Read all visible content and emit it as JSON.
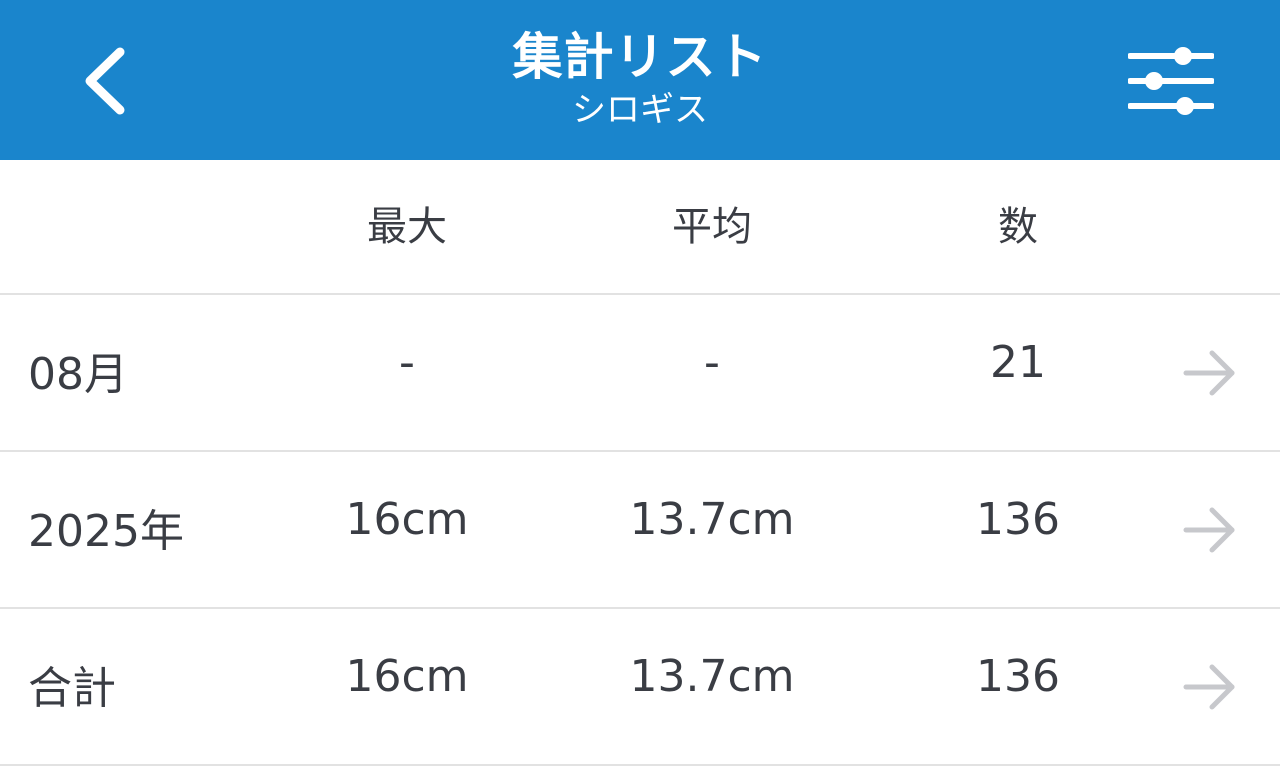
{
  "header": {
    "title": "集計リスト",
    "subtitle": "シロギス",
    "back_icon": "chevron-left-icon",
    "filter_icon": "sliders-icon",
    "background_color": "#1a85cc"
  },
  "columns": {
    "max": "最大",
    "avg": "平均",
    "count": "数"
  },
  "rows": [
    {
      "label": "08月",
      "max": "-",
      "avg": "-",
      "count": "21"
    },
    {
      "label": "2025年",
      "max": "16cm",
      "avg": "13.7cm",
      "count": "136"
    },
    {
      "label": "合計",
      "max": "16cm",
      "avg": "13.7cm",
      "count": "136"
    }
  ],
  "row_icon": "arrow-right-icon"
}
